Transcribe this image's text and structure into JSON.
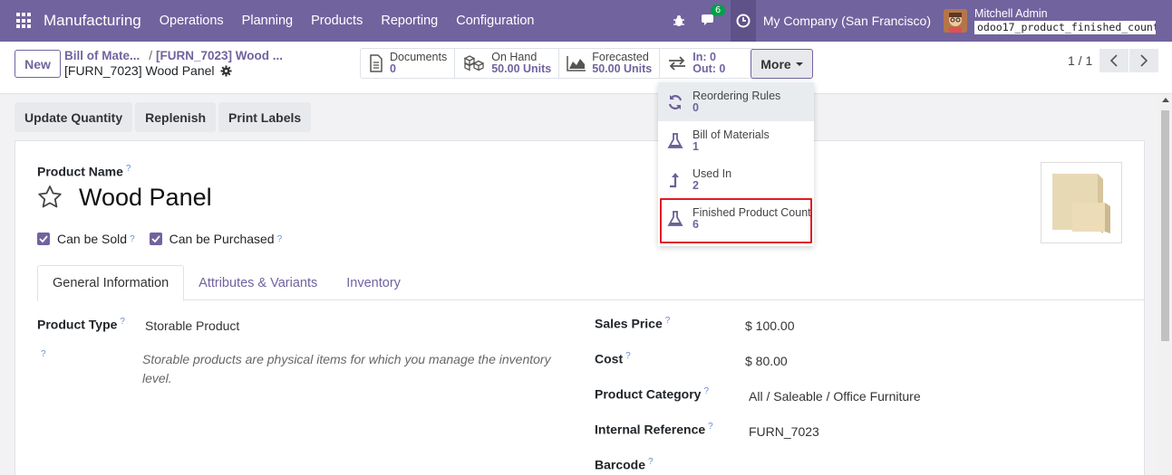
{
  "navbar": {
    "app_name": "Manufacturing",
    "menu": [
      "Operations",
      "Planning",
      "Products",
      "Reporting",
      "Configuration"
    ],
    "chat_count": "6",
    "company": "My Company (San Francisco)",
    "user_name": "Mitchell Admin",
    "db_name": "odoo17_product_finished_count"
  },
  "control": {
    "new_label": "New",
    "breadcrumb_1": "Bill of Mate...",
    "breadcrumb_2": "[FURN_7023] Wood ...",
    "record_title": "[FURN_7023] Wood Panel",
    "stats": {
      "documents": {
        "label": "Documents",
        "value": "0"
      },
      "on_hand": {
        "label": "On Hand",
        "value": "50.00 Units"
      },
      "forecasted": {
        "label": "Forecasted",
        "value": "50.00 Units"
      },
      "in_out": {
        "in": "In: 0",
        "out": "Out: 0"
      }
    },
    "more_label": "More",
    "pager": "1 / 1"
  },
  "dropdown": {
    "items": [
      {
        "label": "Reordering Rules",
        "value": "0",
        "icon": "refresh-icon"
      },
      {
        "label": "Bill of Materials",
        "value": "1",
        "icon": "flask-icon"
      },
      {
        "label": "Used In",
        "value": "2",
        "icon": "level-up-icon"
      },
      {
        "label": "Finished Product Count",
        "value": "6",
        "icon": "flask-icon"
      }
    ]
  },
  "actions": {
    "update_qty": "Update Quantity",
    "replenish": "Replenish",
    "print_labels": "Print Labels"
  },
  "form": {
    "product_name_label": "Product Name",
    "product_name": "Wood Panel",
    "can_be_sold": "Can be Sold",
    "can_be_purchased": "Can be Purchased",
    "tabs": [
      "General Information",
      "Attributes & Variants",
      "Inventory"
    ],
    "product_type_label": "Product Type",
    "product_type": "Storable Product",
    "product_type_help": "Storable products are physical items for which you manage the inventory level.",
    "sales_price_label": "Sales Price",
    "sales_price": "$ 100.00",
    "cost_label": "Cost",
    "cost": "$ 80.00",
    "category_label": "Product Category",
    "category": "All / Saleable / Office Furniture",
    "internal_ref_label": "Internal Reference",
    "internal_ref": "FURN_7023",
    "barcode_label": "Barcode",
    "help_mark": "?"
  },
  "colors": {
    "brand": "#71639e",
    "highlight": "#e01b24"
  }
}
